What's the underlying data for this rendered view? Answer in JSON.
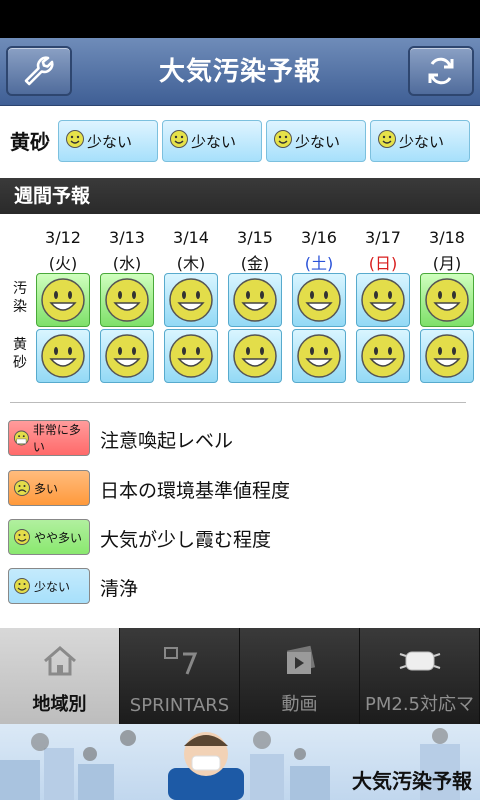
{
  "app": {
    "title": "大気汚染予報"
  },
  "kosa": {
    "label": "黄砂",
    "items": [
      {
        "label": "少ない"
      },
      {
        "label": "少ない"
      },
      {
        "label": "少ない"
      },
      {
        "label": "少ない"
      }
    ]
  },
  "weekly": {
    "header": "週間予報",
    "row_labels": {
      "pollution": [
        "汚",
        "染"
      ],
      "kosa": [
        "黄",
        "砂"
      ]
    },
    "days": [
      {
        "date": "3/12",
        "weekday": "(火)",
        "weekday_color": "#111111",
        "pollution_level": "ややが多い",
        "kosa_level": "少ない"
      },
      {
        "date": "3/13",
        "weekday": "(水)",
        "weekday_color": "#111111",
        "pollution_level": "ややが多い",
        "kosa_level": "少ない"
      },
      {
        "date": "3/14",
        "weekday": "(木)",
        "weekday_color": "#111111",
        "pollution_level": "少ない",
        "kosa_level": "少ない"
      },
      {
        "date": "3/15",
        "weekday": "(金)",
        "weekday_color": "#111111",
        "pollution_level": "少ない",
        "kosa_level": "少ない"
      },
      {
        "date": "3/16",
        "weekday": "(土)",
        "weekday_color": "#2a52d8",
        "pollution_level": "少ない",
        "kosa_level": "少ない"
      },
      {
        "date": "3/17",
        "weekday": "(日)",
        "weekday_color": "#d81d1d",
        "pollution_level": "少ない",
        "kosa_level": "少ない"
      },
      {
        "date": "3/18",
        "weekday": "(月)",
        "weekday_color": "#111111",
        "pollution_level": "ややが多い",
        "kosa_level": "少ない"
      }
    ]
  },
  "legend": [
    {
      "badge": "非常に多い",
      "text": "注意喚起レベル",
      "color": "#ff6a6a",
      "face": "mask-face-icon"
    },
    {
      "badge": "多い",
      "text": "日本の環境基準値程度",
      "color": "#ff9a3c",
      "face": "sad-face-icon"
    },
    {
      "badge": "やや多い",
      "text": "大気が少し霞む程度",
      "color": "#8ae86f",
      "face": "smile-face-icon"
    },
    {
      "badge": "少ない",
      "text": "清浄",
      "color": "#a7e0fb",
      "face": "smile-face-icon"
    }
  ],
  "tabs": [
    {
      "label": "地域別",
      "icon": "home-icon",
      "active": true
    },
    {
      "label": "SPRINTARS",
      "icon": "calendar-icon",
      "active": false
    },
    {
      "label": "動画",
      "icon": "video-icon",
      "active": false
    },
    {
      "label": "PM2.5対応マ",
      "icon": "mask-icon",
      "active": false
    }
  ],
  "banner": {
    "title": "大気汚染予報"
  }
}
